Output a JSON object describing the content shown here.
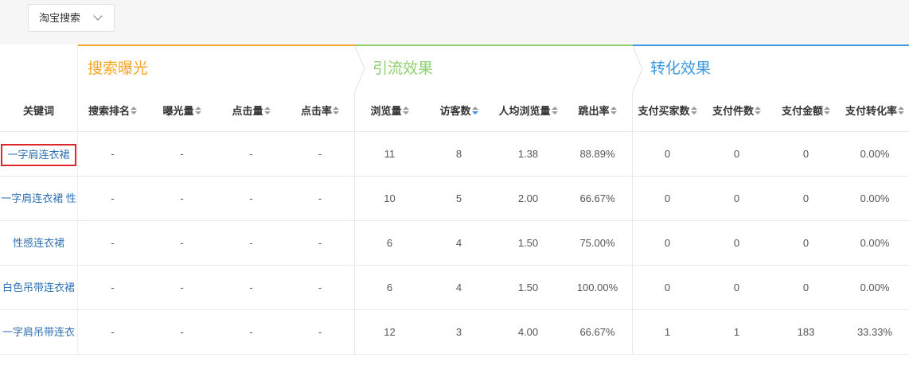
{
  "source_selector": {
    "value": "淘宝搜索",
    "icon": "chevron-down-icon"
  },
  "groups": [
    {
      "label": "搜索曝光"
    },
    {
      "label": "引流效果",
      "icon": "step-arrow-icon"
    },
    {
      "label": "转化效果",
      "icon": "step-arrow-icon"
    }
  ],
  "keyword_header": "关键词",
  "columns": [
    {
      "label": "搜索排名",
      "sort_icon": "sort-icon"
    },
    {
      "label": "曝光量",
      "sort_icon": "sort-icon"
    },
    {
      "label": "点击量",
      "sort_icon": "sort-icon"
    },
    {
      "label": "点击率",
      "sort_icon": "sort-icon"
    },
    {
      "label": "浏览量",
      "sort_icon": "sort-icon"
    },
    {
      "label": "访客数",
      "sort_icon": "sort-desc-icon"
    },
    {
      "label": "人均浏览量",
      "sort_icon": "sort-icon"
    },
    {
      "label": "跳出率",
      "sort_icon": "sort-icon"
    },
    {
      "label": "支付买家数",
      "sort_icon": "sort-icon"
    },
    {
      "label": "支付件数",
      "sort_icon": "sort-icon"
    },
    {
      "label": "支付金额",
      "sort_icon": "sort-icon"
    },
    {
      "label": "支付转化率",
      "sort_icon": "sort-icon"
    }
  ],
  "rows": [
    {
      "keyword": "一字肩连衣裙",
      "values": [
        "-",
        "-",
        "-",
        "-",
        "11",
        "8",
        "1.38",
        "88.89%",
        "0",
        "0",
        "0",
        "0.00%"
      ]
    },
    {
      "keyword": "一字肩连衣裙 性",
      "values": [
        "-",
        "-",
        "-",
        "-",
        "10",
        "5",
        "2.00",
        "66.67%",
        "0",
        "0",
        "0",
        "0.00%"
      ]
    },
    {
      "keyword": "性感连衣裙",
      "values": [
        "-",
        "-",
        "-",
        "-",
        "6",
        "4",
        "1.50",
        "75.00%",
        "0",
        "0",
        "0",
        "0.00%"
      ]
    },
    {
      "keyword": "白色吊带连衣裙",
      "values": [
        "-",
        "-",
        "-",
        "-",
        "6",
        "4",
        "1.50",
        "100.00%",
        "0",
        "0",
        "0",
        "0.00%"
      ]
    },
    {
      "keyword": "一字肩吊带连衣",
      "values": [
        "-",
        "-",
        "-",
        "-",
        "12",
        "3",
        "4.00",
        "66.67%",
        "1",
        "1",
        "183",
        "33.33%"
      ]
    }
  ],
  "colors": {
    "exposure": "#f5a623",
    "traffic": "#8fcf6c",
    "conversion": "#3b98e0",
    "link": "#2f71b4",
    "highlight": "#e0262b",
    "sort-active": "#3a8ee6"
  }
}
